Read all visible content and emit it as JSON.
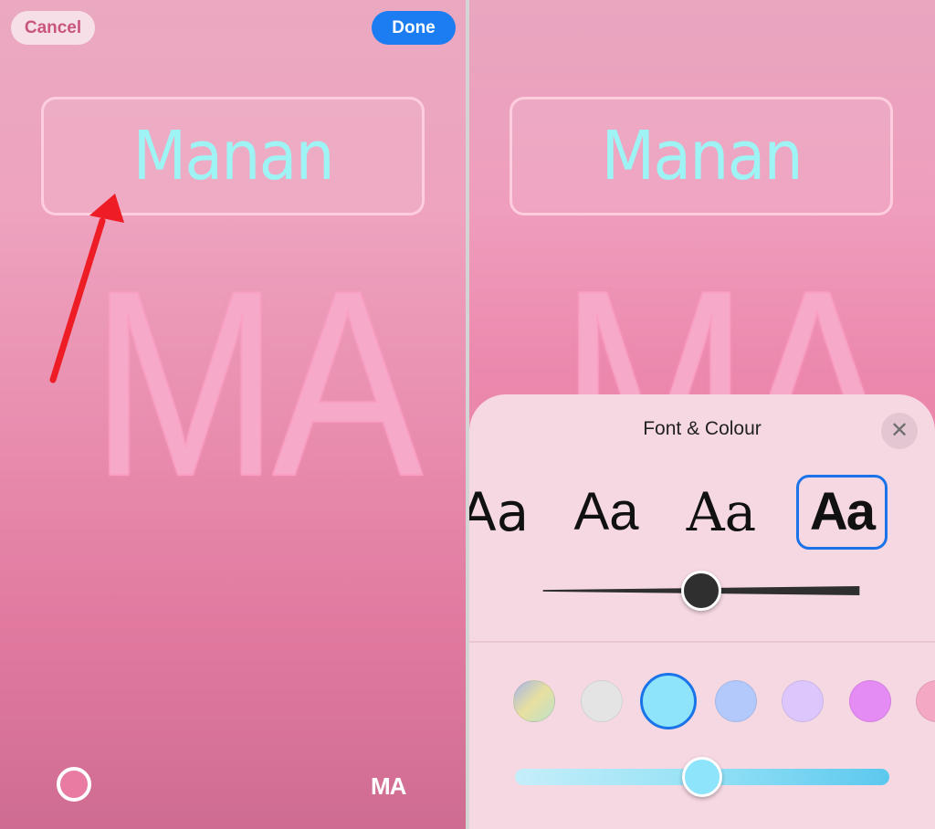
{
  "left": {
    "cancel_label": "Cancel",
    "done_label": "Done",
    "name_text": "Manan",
    "monogram_big": "MA",
    "monogram_label": "MA",
    "color_circle_color": "#e97aa2"
  },
  "right": {
    "name_text": "Manan",
    "monogram_big": "MA",
    "sheet": {
      "title": "Font & Colour",
      "close_glyph": "✕",
      "font_options": [
        "Aa",
        "Aa",
        "Aa",
        "Aa"
      ],
      "selected_font_index": 3,
      "size_slider_value": 0.5,
      "colour_slider_value": 0.5,
      "swatches": [
        "#c4d2c8",
        "#e4e4e4",
        "#8ee4fb",
        "#b3c8fb",
        "#dcc6fb",
        "#e58bf4",
        "#f4a8c4"
      ],
      "selected_swatch_index": 2
    }
  },
  "colors": {
    "accent": "#1a73e8",
    "done_button": "#1c7df3",
    "name_text": "#9ef3f4"
  }
}
